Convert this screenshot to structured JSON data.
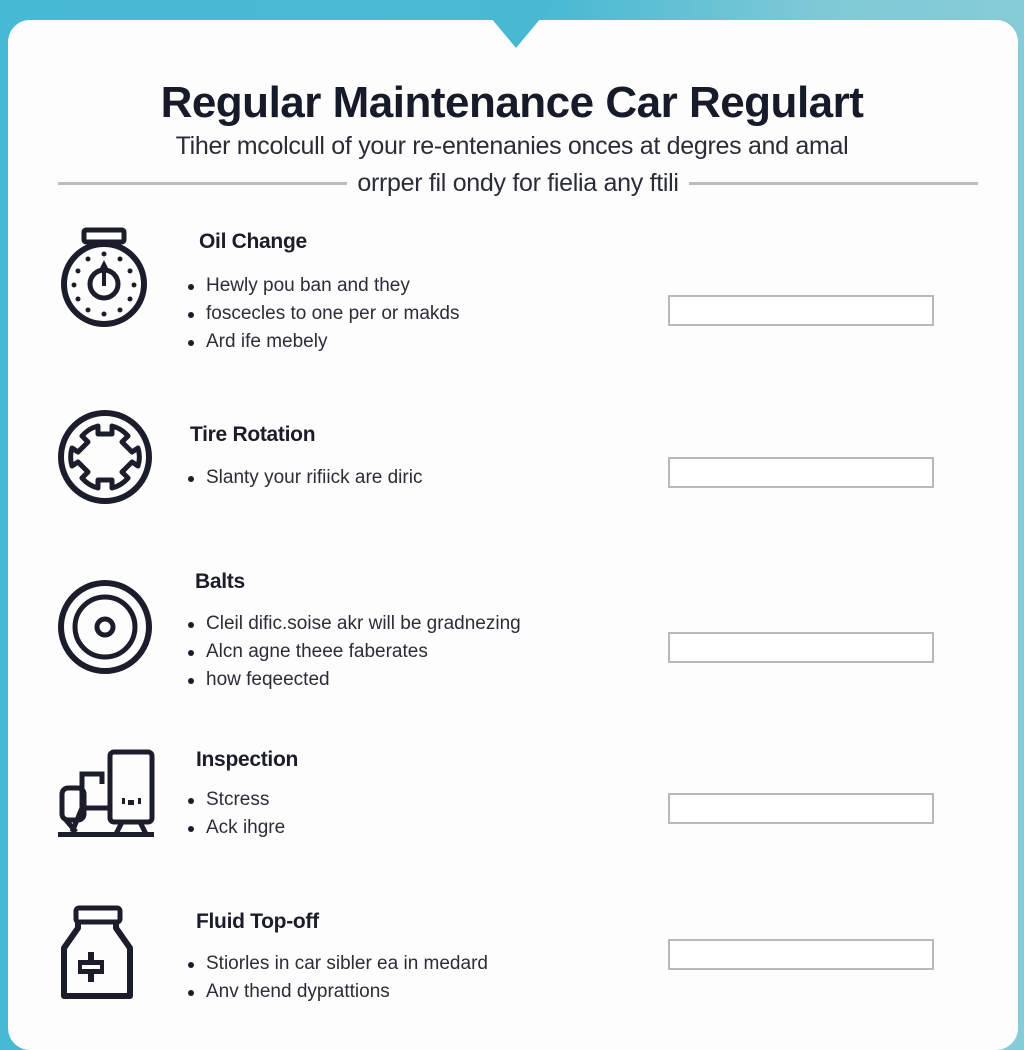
{
  "header": {
    "title": "Regular Maintenance Car Regulart",
    "subtitle_line1": "Tiher mcolcull of your re-entenanies onces at degres and amal",
    "subtitle_line2": "orrper fil ondy for fielia any ftili"
  },
  "colors": {
    "background_accent": "#46b9d4",
    "text_dark": "#1b1d2b",
    "field_border": "#b9b9b9"
  },
  "sections": [
    {
      "title": "Oil Change",
      "icon": "oil-gauge-icon",
      "bullets": [
        "Hewly pou ban and they",
        "foscecles to one per or makds",
        "Ard ife mebely"
      ],
      "field_value": ""
    },
    {
      "title": "Tire Rotation",
      "icon": "tire-icon",
      "bullets": [
        "Slanty your rifiick are diric"
      ],
      "field_value": ""
    },
    {
      "title": "Balts",
      "icon": "target-ring-icon",
      "bullets": [
        "Cleil dific.soise akr will be gradnezing",
        "Alcn agne theee faberates",
        "how feqeected"
      ],
      "field_value": ""
    },
    {
      "title": "Inspection",
      "icon": "inspection-machines-icon",
      "bullets": [
        "Stcress",
        "Ack ihgre"
      ],
      "field_value": ""
    },
    {
      "title": "Fluid Top-off",
      "icon": "fluid-bottle-icon",
      "bullets": [
        "Stiorles in car sibler ea in medard",
        "Anv thend dyprattions"
      ],
      "field_value": ""
    }
  ]
}
